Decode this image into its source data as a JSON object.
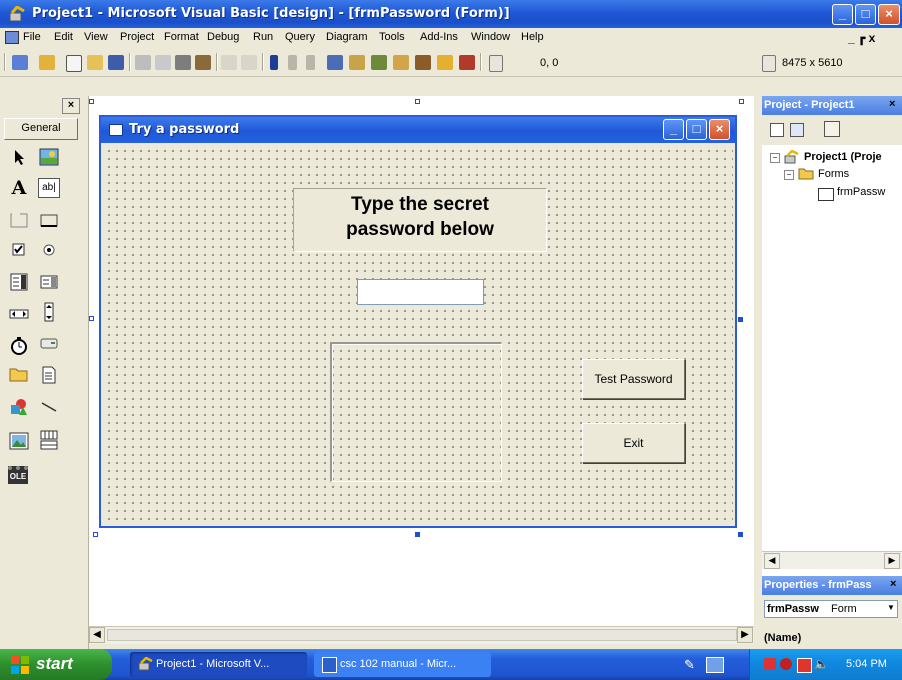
{
  "window": {
    "title": "Project1 - Microsoft Visual Basic [design] - [frmPassword (Form)]"
  },
  "menu": {
    "items": [
      "File",
      "Edit",
      "View",
      "Project",
      "Format",
      "Debug",
      "Run",
      "Query",
      "Diagram",
      "Tools",
      "Add-Ins",
      "Window",
      "Help"
    ],
    "doc_controls": "_ ┏ x"
  },
  "toolbar": {
    "position": "0, 0",
    "size": "8475 x 5610"
  },
  "toolbox": {
    "tab_label": "General",
    "close": "×",
    "tools": [
      "pointer-icon",
      "picturebox-icon",
      "label-icon",
      "textbox-icon",
      "frame-icon",
      "commandbutton-icon",
      "checkbox-icon",
      "optionbutton-icon",
      "combobox-icon",
      "listbox-icon",
      "hscrollbar-icon",
      "vscrollbar-icon",
      "timer-icon",
      "drivelistbox-icon",
      "dirlistbox-icon",
      "filelistbox-icon",
      "shape-icon",
      "line-icon",
      "image-icon",
      "data-icon",
      "ole-icon"
    ],
    "label_glyph": "A",
    "textbox_glyph": "ab|",
    "ole_glyph": "OLE"
  },
  "form": {
    "title": "Try a password",
    "label_text": "Type the secret password below",
    "textbox_value": "",
    "buttons": {
      "test_label": "Test Password",
      "exit_label": "Exit"
    }
  },
  "project_panel": {
    "title": "Project - Project1",
    "tree": {
      "root": "Project1 (Proje",
      "folder": "Forms",
      "item": "frmPassw"
    }
  },
  "properties_panel": {
    "title": "Properties - frmPass",
    "object": "frmPassw",
    "object_type": "Form",
    "first_property": "(Name)"
  },
  "taskbar": {
    "start_label": "start",
    "tasks": [
      "Project1 - Microsoft V...",
      "csc 102 manual - Micr..."
    ],
    "clock": "5:04 PM"
  },
  "colors": {
    "titlebar": "#1f58d6",
    "taskbar": "#245edb",
    "start": "#2d8f2d",
    "form_bg": "#ece9d8"
  }
}
